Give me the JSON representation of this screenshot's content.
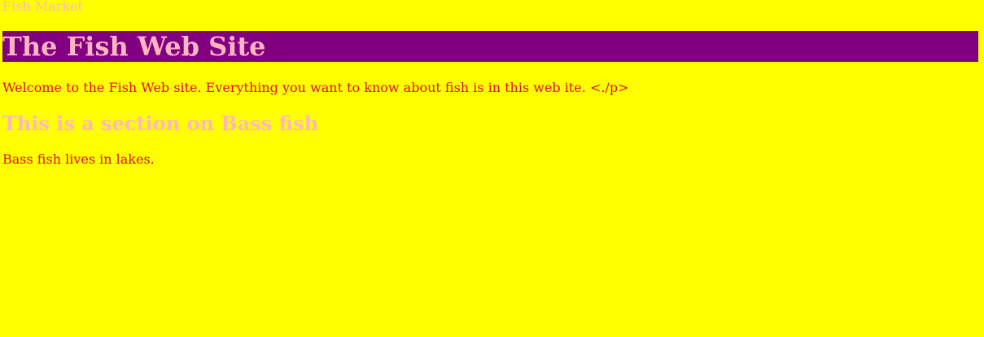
{
  "page": {
    "site_label": "Fish Market",
    "heading": "The Fish Web Site",
    "intro": "Welcome to the Fish Web site. Everything you want to know about fish is in this web ite. <./p>",
    "section_heading": "This is a section on Bass fish",
    "section_text": "Bass fish lives in lakes."
  },
  "colors": {
    "background": "#ffff00",
    "heading_bar": "#800080",
    "pink_text": "#ffb6c1",
    "body_text": "#e0102a"
  }
}
